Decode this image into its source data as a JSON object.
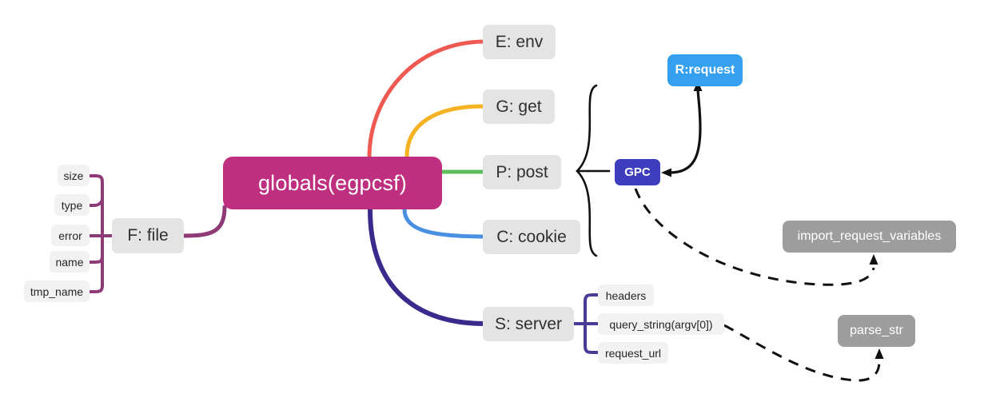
{
  "diagram": {
    "title": "globals(egpcsf)",
    "root": {
      "label": "globals(egpcsf)",
      "color": "#bf2f7f"
    },
    "branches": [
      {
        "id": "env",
        "label": "E: env",
        "color": "#ee5a52"
      },
      {
        "id": "get",
        "label": "G: get",
        "color": "#f5b324"
      },
      {
        "id": "post",
        "label": "P: post",
        "color": "#5cbf5c"
      },
      {
        "id": "cookie",
        "label": "C: cookie",
        "color": "#4a90e2"
      },
      {
        "id": "server",
        "label": "S: server",
        "color": "#3b2a8c"
      },
      {
        "id": "file",
        "label": "F: file",
        "color": "#8e3a77"
      }
    ],
    "file_children": [
      {
        "label": "size"
      },
      {
        "label": "type"
      },
      {
        "label": "error"
      },
      {
        "label": "name"
      },
      {
        "label": "tmp_name"
      }
    ],
    "server_children": [
      {
        "label": "headers"
      },
      {
        "label": "query_string(argv[0])"
      },
      {
        "label": "request_url"
      }
    ],
    "group": {
      "label": "GPC",
      "members": [
        "G: get",
        "P: post",
        "C: cookie"
      ],
      "color": "#3d3dbd"
    },
    "targets": [
      {
        "id": "request",
        "label": "R:request",
        "color": "#35a0f0"
      },
      {
        "id": "import_request_variables",
        "label": "import_request_variables",
        "color": "#9d9d9d"
      },
      {
        "id": "parse_str",
        "label": "parse_str",
        "color": "#9d9d9d"
      }
    ],
    "connector_colors": {
      "brace": "#1a1a1a",
      "dashed": "#1a1a1a",
      "file_bracket": "#8e3a77",
      "server_bracket": "#4a3b96"
    }
  }
}
